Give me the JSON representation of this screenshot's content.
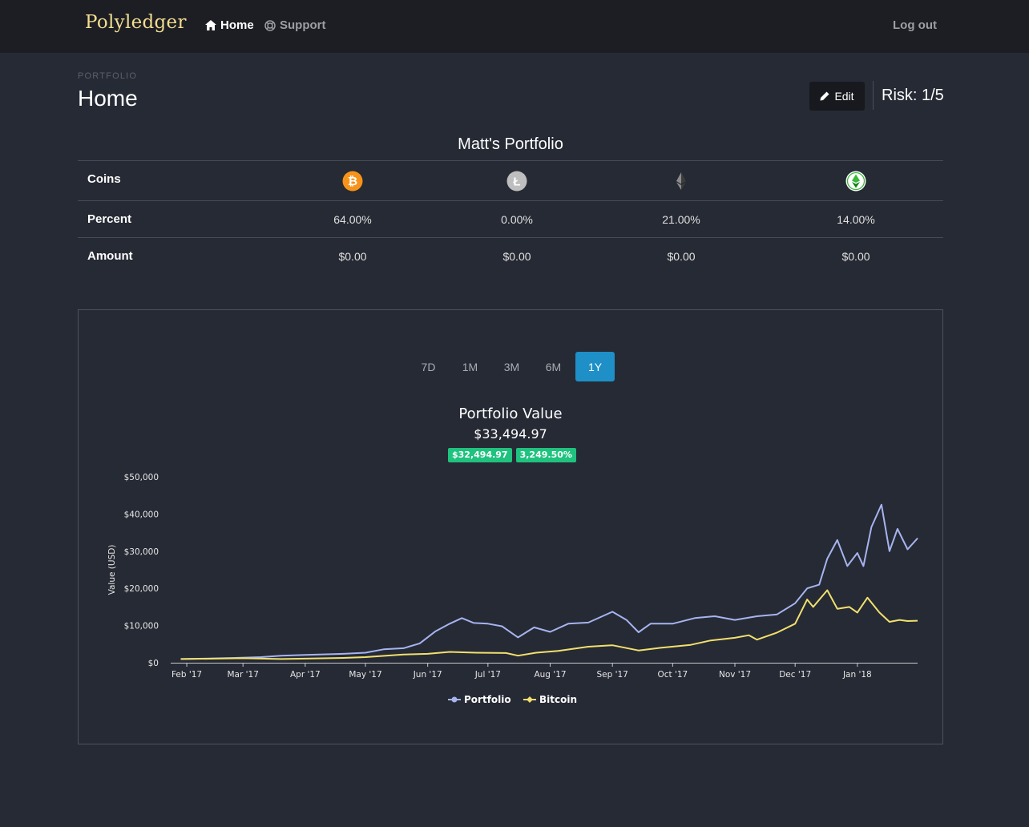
{
  "nav": {
    "brand": "Polyledger",
    "home_label": "Home",
    "support_label": "Support",
    "logout_label": "Log out"
  },
  "header": {
    "overline": "PORTFOLIO",
    "title": "Home",
    "edit_label": "Edit",
    "risk_label": "Risk: 1/5"
  },
  "portfolio": {
    "name": "Matt's Portfolio",
    "row_labels": {
      "coins": "Coins",
      "percent": "Percent",
      "amount": "Amount"
    },
    "coins": [
      {
        "icon": "bitcoin-icon",
        "color": "#f7931a",
        "percent": "64.00%",
        "amount": "$0.00"
      },
      {
        "icon": "litecoin-icon",
        "color": "#bebebe",
        "percent": "0.00%",
        "amount": "$0.00"
      },
      {
        "icon": "ethereum-icon",
        "color": "#3c3c3d",
        "percent": "21.00%",
        "amount": "$0.00"
      },
      {
        "icon": "ethereum-classic-icon",
        "color": "#3ab83a",
        "percent": "14.00%",
        "amount": "$0.00"
      }
    ]
  },
  "chart_panel": {
    "ranges": [
      "7D",
      "1M",
      "3M",
      "6M",
      "1Y"
    ],
    "active_range": "1Y",
    "title": "Portfolio Value",
    "value": "$33,494.97",
    "gain_amount": "$32,494.97",
    "gain_percent": "3,249.50%"
  },
  "colors": {
    "portfolio": "#a6b4f0",
    "bitcoin": "#f2e06e",
    "accent": "#1e8fc7",
    "gain": "#1fc27e"
  },
  "chart_data": {
    "type": "line",
    "title": "Portfolio Value",
    "ylabel": "Value (USD)",
    "xlabel": "",
    "ylim": [
      0,
      50000
    ],
    "xlim": [
      "2017-01-24",
      "2018-01-31"
    ],
    "y_ticks": [
      "$0",
      "$10,000",
      "$20,000",
      "$30,000",
      "$40,000",
      "$50,000"
    ],
    "y_tick_values": [
      0,
      10000,
      20000,
      30000,
      40000,
      50000
    ],
    "x_ticks": [
      {
        "label": "Feb '17",
        "date": "2017-02-01"
      },
      {
        "label": "Mar '17",
        "date": "2017-03-01"
      },
      {
        "label": "Apr '17",
        "date": "2017-04-01"
      },
      {
        "label": "May '17",
        "date": "2017-05-01"
      },
      {
        "label": "Jun '17",
        "date": "2017-06-01"
      },
      {
        "label": "Jul '17",
        "date": "2017-07-01"
      },
      {
        "label": "Aug '17",
        "date": "2017-08-01"
      },
      {
        "label": "Sep '17",
        "date": "2017-09-01"
      },
      {
        "label": "Oct '17",
        "date": "2017-10-01"
      },
      {
        "label": "Nov '17",
        "date": "2017-11-01"
      },
      {
        "label": "Dec '17",
        "date": "2017-12-01"
      },
      {
        "label": "Jan '18",
        "date": "2018-01-01"
      }
    ],
    "legend_position": "bottom-center",
    "grid": false,
    "series": [
      {
        "name": "Portfolio",
        "points": [
          [
            "2017-01-29",
            1000
          ],
          [
            "2017-02-10",
            1100
          ],
          [
            "2017-02-25",
            1300
          ],
          [
            "2017-03-10",
            1500
          ],
          [
            "2017-03-20",
            1900
          ],
          [
            "2017-04-01",
            2100
          ],
          [
            "2017-04-20",
            2400
          ],
          [
            "2017-05-01",
            2700
          ],
          [
            "2017-05-10",
            3600
          ],
          [
            "2017-05-20",
            3900
          ],
          [
            "2017-05-28",
            5200
          ],
          [
            "2017-06-05",
            8500
          ],
          [
            "2017-06-12",
            10500
          ],
          [
            "2017-06-18",
            12000
          ],
          [
            "2017-06-24",
            10700
          ],
          [
            "2017-07-01",
            10500
          ],
          [
            "2017-07-08",
            9800
          ],
          [
            "2017-07-16",
            6800
          ],
          [
            "2017-07-24",
            9500
          ],
          [
            "2017-08-01",
            8300
          ],
          [
            "2017-08-10",
            10500
          ],
          [
            "2017-08-20",
            10800
          ],
          [
            "2017-09-01",
            13700
          ],
          [
            "2017-09-08",
            11500
          ],
          [
            "2017-09-14",
            8200
          ],
          [
            "2017-09-20",
            10500
          ],
          [
            "2017-10-01",
            10500
          ],
          [
            "2017-10-12",
            12000
          ],
          [
            "2017-10-22",
            12500
          ],
          [
            "2017-11-01",
            11500
          ],
          [
            "2017-11-12",
            12500
          ],
          [
            "2017-11-22",
            13000
          ],
          [
            "2017-12-01",
            16000
          ],
          [
            "2017-12-07",
            20000
          ],
          [
            "2017-12-13",
            21000
          ],
          [
            "2017-12-17",
            28000
          ],
          [
            "2017-12-22",
            33000
          ],
          [
            "2017-12-27",
            26000
          ],
          [
            "2018-01-01",
            29500
          ],
          [
            "2018-01-04",
            26000
          ],
          [
            "2018-01-08",
            36500
          ],
          [
            "2018-01-13",
            42500
          ],
          [
            "2018-01-17",
            30000
          ],
          [
            "2018-01-21",
            36000
          ],
          [
            "2018-01-26",
            30500
          ],
          [
            "2018-01-31",
            33500
          ]
        ]
      },
      {
        "name": "Bitcoin",
        "points": [
          [
            "2017-01-29",
            1000
          ],
          [
            "2017-02-15",
            1100
          ],
          [
            "2017-03-01",
            1200
          ],
          [
            "2017-03-20",
            1000
          ],
          [
            "2017-04-01",
            1100
          ],
          [
            "2017-04-20",
            1300
          ],
          [
            "2017-05-01",
            1500
          ],
          [
            "2017-05-20",
            2200
          ],
          [
            "2017-06-01",
            2400
          ],
          [
            "2017-06-12",
            2900
          ],
          [
            "2017-06-25",
            2700
          ],
          [
            "2017-07-10",
            2600
          ],
          [
            "2017-07-16",
            1900
          ],
          [
            "2017-07-25",
            2700
          ],
          [
            "2017-08-05",
            3200
          ],
          [
            "2017-08-20",
            4300
          ],
          [
            "2017-09-01",
            4700
          ],
          [
            "2017-09-14",
            3300
          ],
          [
            "2017-09-25",
            4000
          ],
          [
            "2017-10-10",
            4800
          ],
          [
            "2017-10-20",
            6000
          ],
          [
            "2017-11-01",
            6700
          ],
          [
            "2017-11-08",
            7400
          ],
          [
            "2017-11-12",
            6200
          ],
          [
            "2017-11-22",
            8100
          ],
          [
            "2017-12-01",
            10500
          ],
          [
            "2017-12-07",
            17000
          ],
          [
            "2017-12-10",
            15000
          ],
          [
            "2017-12-17",
            19500
          ],
          [
            "2017-12-22",
            14500
          ],
          [
            "2017-12-28",
            15000
          ],
          [
            "2018-01-01",
            13500
          ],
          [
            "2018-01-06",
            17500
          ],
          [
            "2018-01-12",
            13500
          ],
          [
            "2018-01-17",
            11000
          ],
          [
            "2018-01-22",
            11500
          ],
          [
            "2018-01-26",
            11200
          ],
          [
            "2018-01-31",
            11300
          ]
        ]
      }
    ]
  }
}
